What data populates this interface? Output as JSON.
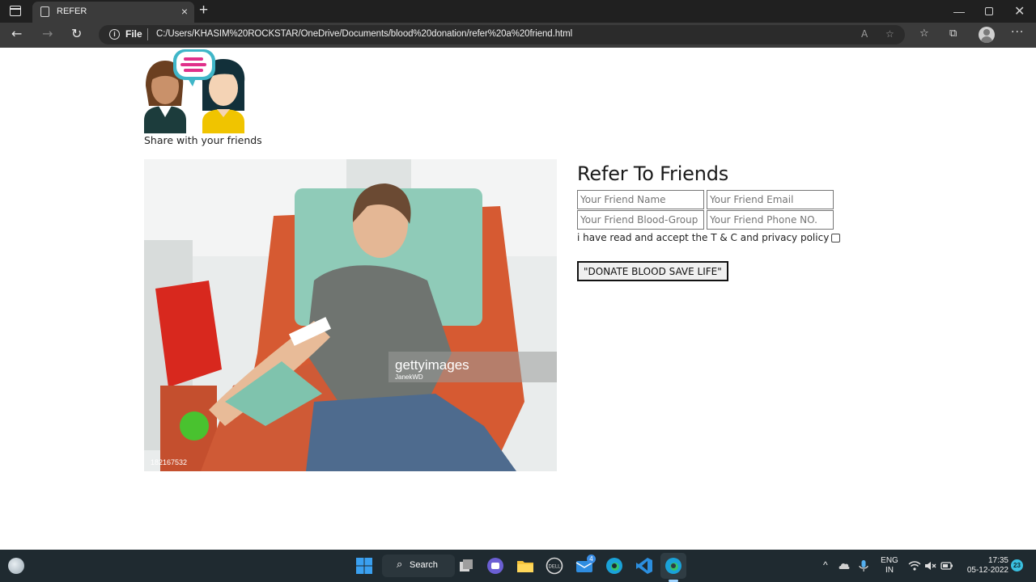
{
  "browser": {
    "tab_title": "REFER",
    "tab_close": "×",
    "new_tab": "+",
    "address_prefix": "File",
    "url": "C:/Users/KHASIM%20ROCKSTAR/OneDrive/Documents/blood%20donation/refer%20a%20friend.html",
    "more_label": "···",
    "win_min": "—",
    "win_close": "✕"
  },
  "page": {
    "share_caption": "Share with your friends",
    "heading": "Refer To Friends",
    "fields": {
      "name_placeholder": "Your Friend Name",
      "email_placeholder": "Your Friend Email",
      "blood_group_placeholder": "Your Friend Blood-Group",
      "phone_placeholder": "Your Friend Phone NO."
    },
    "terms_text": "i have read and accept the T & C and privacy policy",
    "submit_label": "\"DONATE BLOOD SAVE LIFE\"",
    "photo_watermark": "gettyimages",
    "photo_credit": "JanekWD",
    "photo_id": "182167532"
  },
  "taskbar": {
    "search_label": "Search",
    "language_line1": "ENG",
    "language_line2": "IN",
    "time": "17:35",
    "date": "05-12-2022",
    "mail_badge": "4",
    "notification_count": "23",
    "tray_overflow": "^"
  },
  "colors": {
    "titlebar": "#202020",
    "toolbar": "#3b3b3b",
    "taskbar": "#1f2a30"
  }
}
